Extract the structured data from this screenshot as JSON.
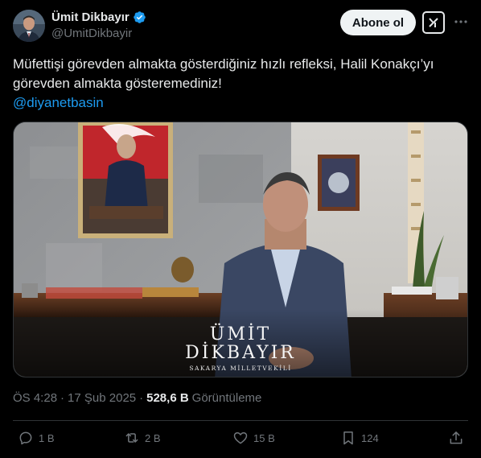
{
  "author": {
    "name": "Ümit Dikbayır",
    "handle": "@UmitDikbayir",
    "verified": true
  },
  "header": {
    "follow_label": "Abone ol"
  },
  "tweet": {
    "text": "Müfettişi görevden almakta gösterdiğiniz hızlı refleksi, Halil Konakçı’yı görevden almakta gösteremediniz!",
    "mention": "@diyanetbasin"
  },
  "media": {
    "caption_line1": "ÜMİT",
    "caption_line2": "DİKBAYIR",
    "caption_line3": "SAKARYA MİLLETVEKİLİ"
  },
  "meta": {
    "time": "ÖS 4:28",
    "separator": "·",
    "date": "17 Şub 2025",
    "separator2": "·",
    "views_count": "528,6 B",
    "views_label": "Görüntüleme"
  },
  "actions": {
    "replies": "1 B",
    "reposts": "2 B",
    "likes": "15 B",
    "bookmarks": "124"
  },
  "colors": {
    "background": "#000000",
    "text": "#e7e9ea",
    "secondary": "#71767b",
    "link": "#1d9bf0",
    "verified": "#1d9bf0"
  }
}
